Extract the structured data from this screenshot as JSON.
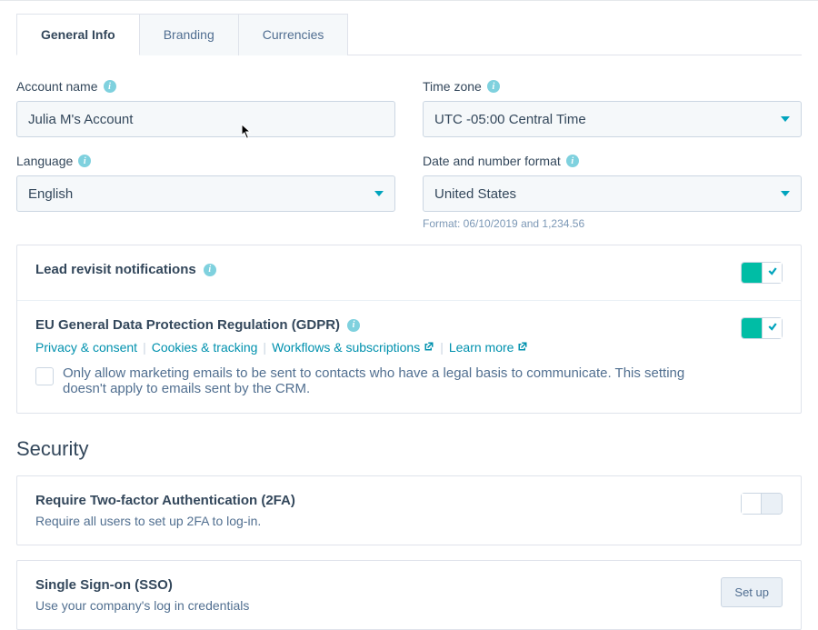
{
  "tabs": {
    "general": "General Info",
    "branding": "Branding",
    "currencies": "Currencies"
  },
  "fields": {
    "account_name": {
      "label": "Account name",
      "value": "Julia M's Account"
    },
    "time_zone": {
      "label": "Time zone",
      "value": "UTC -05:00 Central Time"
    },
    "language": {
      "label": "Language",
      "value": "English"
    },
    "date_format": {
      "label": "Date and number format",
      "value": "United States",
      "hint": "Format: 06/10/2019 and 1,234.56"
    }
  },
  "lead_notifications": {
    "title": "Lead revisit notifications"
  },
  "gdpr": {
    "title": "EU General Data Protection Regulation (GDPR)",
    "links": {
      "privacy": "Privacy & consent",
      "cookies": "Cookies & tracking",
      "workflows": "Workflows & subscriptions",
      "learn": "Learn more"
    },
    "checkbox_text": "Only allow marketing emails to be sent to contacts who have a legal basis to communicate. This setting doesn't apply to emails sent by the CRM."
  },
  "security": {
    "heading": "Security",
    "twofa": {
      "title": "Require Two-factor Authentication (2FA)",
      "desc": "Require all users to set up 2FA to log-in."
    },
    "sso": {
      "title": "Single Sign-on (SSO)",
      "desc": "Use your company's log in credentials",
      "button": "Set up"
    }
  }
}
